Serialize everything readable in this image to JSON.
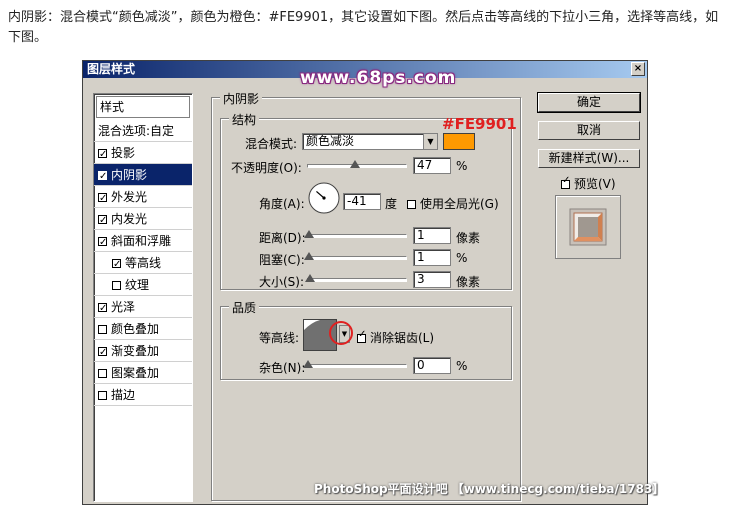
{
  "intro_text": "内阴影：混合模式“颜色减淡”，颜色为橙色：#FE9901，其它设置如下图。然后点击等高线的下拉小三角，选择等高线，如下图。",
  "watermark_top": "www.68ps.com",
  "watermark_bottom": "PhotoShop平面设计吧 【www.tinecg.com/tieba/1783】",
  "dialog": {
    "title": "图层样式",
    "close": "×"
  },
  "styles_list": {
    "header": "样式",
    "items": [
      {
        "label": "混合选项:自定",
        "checkbox": false,
        "checked": false,
        "selected": false,
        "indent": false
      },
      {
        "label": "投影",
        "checkbox": true,
        "checked": true,
        "selected": false,
        "indent": false
      },
      {
        "label": "内阴影",
        "checkbox": true,
        "checked": true,
        "selected": true,
        "indent": false
      },
      {
        "label": "外发光",
        "checkbox": true,
        "checked": true,
        "selected": false,
        "indent": false
      },
      {
        "label": "内发光",
        "checkbox": true,
        "checked": true,
        "selected": false,
        "indent": false
      },
      {
        "label": "斜面和浮雕",
        "checkbox": true,
        "checked": true,
        "selected": false,
        "indent": false
      },
      {
        "label": "等高线",
        "checkbox": true,
        "checked": true,
        "selected": false,
        "indent": true
      },
      {
        "label": "纹理",
        "checkbox": true,
        "checked": false,
        "selected": false,
        "indent": true
      },
      {
        "label": "光泽",
        "checkbox": true,
        "checked": true,
        "selected": false,
        "indent": false
      },
      {
        "label": "颜色叠加",
        "checkbox": true,
        "checked": false,
        "selected": false,
        "indent": false
      },
      {
        "label": "渐变叠加",
        "checkbox": true,
        "checked": true,
        "selected": false,
        "indent": false
      },
      {
        "label": "图案叠加",
        "checkbox": true,
        "checked": false,
        "selected": false,
        "indent": false
      },
      {
        "label": "描边",
        "checkbox": true,
        "checked": false,
        "selected": false,
        "indent": false
      }
    ]
  },
  "inner_shadow": {
    "group_title": "内阴影",
    "structure_title": "结构",
    "color_annotation": "#FE9901",
    "color_hex": "#FE9901",
    "blend_mode_label": "混合模式:",
    "blend_mode_value": "颜色减淡",
    "opacity_label": "不透明度(O):",
    "opacity_value": "47",
    "opacity_fraction": 0.47,
    "opacity_unit": "%",
    "angle_label": "角度(A):",
    "angle_value": "-41",
    "angle_unit": "度",
    "global_light_label": "使用全局光(G)",
    "global_light_checked": false,
    "distance_label": "距离(D):",
    "distance_value": "1",
    "distance_unit": "像素",
    "choke_label": "阻塞(C):",
    "choke_value": "1",
    "choke_unit": "%",
    "size_label": "大小(S):",
    "size_value": "3",
    "size_unit": "像素"
  },
  "quality": {
    "title": "品质",
    "contour_label": "等高线:",
    "antialias_label": "消除锯齿(L)",
    "antialias_checked": true,
    "noise_label": "杂色(N):",
    "noise_value": "0",
    "noise_unit": "%"
  },
  "buttons": {
    "ok": "确定",
    "cancel": "取消",
    "new_style": "新建样式(W)...",
    "preview_label": "预览(V)",
    "preview_checked": true
  },
  "colors": {
    "highlight_red": "#e02020",
    "selected_bg": "#0a246a",
    "dialog_bg": "#d4d0c8"
  }
}
